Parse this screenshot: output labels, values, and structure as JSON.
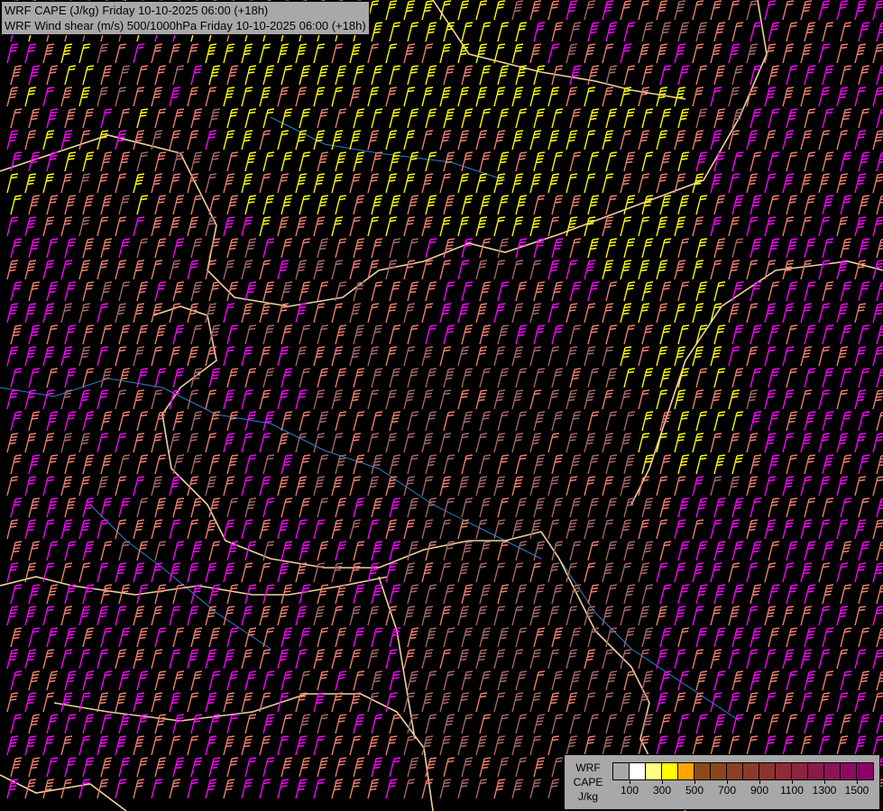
{
  "title": {
    "line1": "WRF CAPE (J/kg) Friday 10-10-2025 06:00 (+18h)",
    "line2": "WRF Wind shear (m/s) 500/1000hPa Friday 10-10-2025 06:00 (+18h)"
  },
  "legend": {
    "label_lines": [
      "WRF",
      "CAPE",
      "J/kg"
    ],
    "colors": [
      "#a8a8a8",
      "#ffffff",
      "#ffff80",
      "#ffff00",
      "#ffa500",
      "#8b4a14",
      "#8b461e",
      "#8b4024",
      "#8b3a2a",
      "#8b3430",
      "#8b2c38",
      "#8b2440",
      "#8b1c4a",
      "#8b1454",
      "#8b0c5e",
      "#8b0068"
    ],
    "ticks": [
      "100",
      "300",
      "500",
      "700",
      "900",
      "1100",
      "1300",
      "1500"
    ]
  },
  "barb_colors": {
    "yellow": "#ffff00",
    "salmon": "#f08070",
    "magenta": "#ff00ff",
    "brown": "#a86868",
    "border": "#f0d0a0",
    "river": "#3080d0"
  }
}
